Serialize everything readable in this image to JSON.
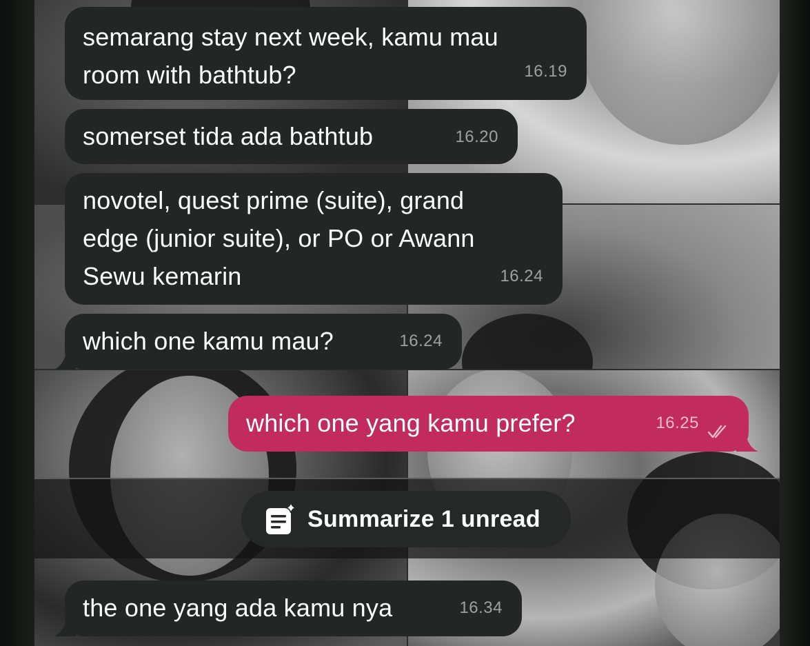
{
  "chat": {
    "messages": [
      {
        "direction": "incoming",
        "lines": [
          "semarang stay next week, kamu mau",
          "room with bathtub?"
        ],
        "time": "16.19"
      },
      {
        "direction": "incoming",
        "lines": [
          "somerset tida ada bathtub"
        ],
        "time": "16.20"
      },
      {
        "direction": "incoming",
        "lines": [
          "novotel, quest prime (suite), grand",
          "edge (junior suite), or PO or Awann",
          "Sewu kemarin"
        ],
        "time": "16.24"
      },
      {
        "direction": "incoming",
        "lines": [
          "which one kamu mau?"
        ],
        "time": "16.24"
      },
      {
        "direction": "outgoing",
        "lines": [
          "which one yang kamu prefer?"
        ],
        "time": "16.25",
        "status": "read"
      },
      {
        "direction": "incoming",
        "lines": [
          "the one yang ada kamu nya"
        ],
        "time": "16.34"
      }
    ],
    "read_status_icon": "double-check-icon"
  },
  "summarize": {
    "label": "Summarize 1 unread",
    "icon": "summarize-notes-sparkle-icon"
  },
  "colors": {
    "incoming_bubble": "#242626",
    "outgoing_bubble": "#c22b5e",
    "text": "#ffffff",
    "timestamp": "#9ea0a1"
  }
}
